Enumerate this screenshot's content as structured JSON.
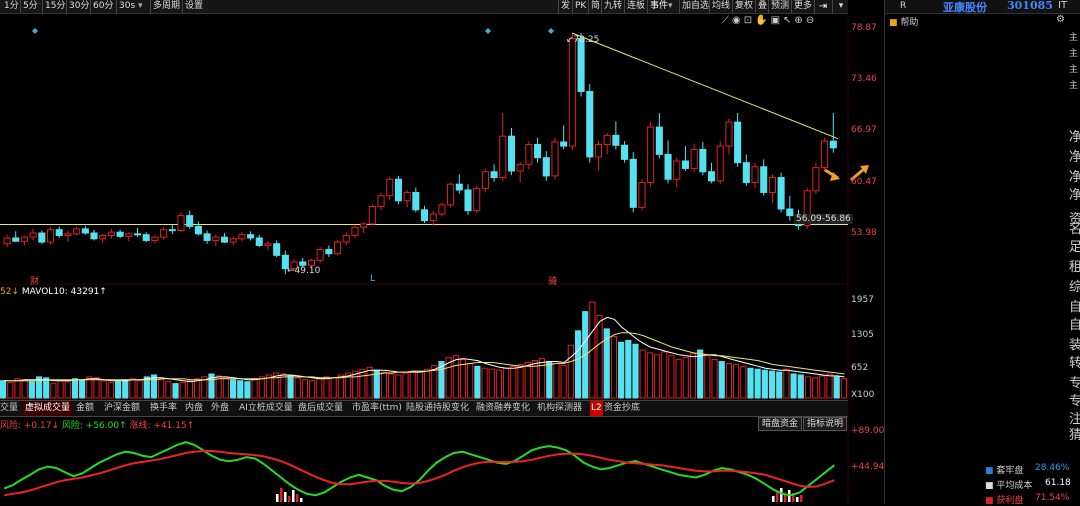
{
  "toolbar": {
    "periods": [
      "1分",
      "5分",
      "15分",
      "30分",
      "60分",
      "30s",
      "多周期",
      "设置"
    ],
    "tools": [
      "发",
      "PK",
      "简",
      "九转",
      "连板",
      "事件",
      "加自选",
      "均线",
      "复权",
      "叠",
      "预测",
      "更多"
    ]
  },
  "stock": {
    "code_letter": "R",
    "name": "亚康股份",
    "code": "301085",
    "help": "帮助",
    "it_label": "IT"
  },
  "price_axis": [
    "78.87",
    "73.46",
    "66.97",
    "60.47",
    "53.98"
  ],
  "annotations": {
    "high": "78.25",
    "low": "49.10",
    "box_label": "56.09-56.86",
    "marker_cai": "财",
    "marker_l": "L",
    "marker_xiang": "骑"
  },
  "volume": {
    "header_value": "52↓",
    "header": "MAVOL10: 43291↑",
    "axis": [
      "1957",
      "1305",
      "652",
      "X100"
    ],
    "bars": [
      18,
      16,
      20,
      19,
      17,
      22,
      21,
      15,
      18,
      17,
      20,
      19,
      22,
      21,
      18,
      16,
      17,
      19,
      20,
      18,
      22,
      24,
      19,
      17,
      15,
      16,
      18,
      20,
      22,
      25,
      23,
      21,
      19,
      18,
      17,
      20,
      22,
      24,
      26,
      25,
      23,
      21,
      19,
      18,
      20,
      22,
      21,
      24,
      26,
      28,
      30,
      32,
      29,
      27,
      25,
      24,
      26,
      28,
      27,
      30,
      34,
      38,
      42,
      44,
      40,
      36,
      33,
      31,
      30,
      29,
      31,
      33,
      35,
      37,
      39,
      41,
      38,
      36,
      34,
      55,
      70,
      90,
      100,
      86,
      72,
      64,
      58,
      60,
      56,
      50,
      47,
      45,
      48,
      44,
      40,
      42,
      46,
      50,
      44,
      40,
      38,
      36,
      35,
      33,
      31,
      30,
      29,
      28,
      27,
      30,
      25,
      24,
      22,
      21,
      23,
      25,
      22,
      20
    ],
    "ma5": [
      18,
      18,
      18,
      19,
      19,
      19,
      19,
      18,
      18,
      18,
      19,
      19,
      20,
      20,
      19,
      18,
      18,
      18,
      19,
      19,
      20,
      21,
      21,
      20,
      19,
      18,
      17,
      18,
      19,
      21,
      22,
      22,
      21,
      20,
      19,
      19,
      20,
      21,
      23,
      24,
      24,
      23,
      22,
      21,
      20,
      20,
      21,
      22,
      23,
      25,
      27,
      29,
      29,
      29,
      28,
      27,
      27,
      27,
      27,
      28,
      30,
      33,
      37,
      40,
      41,
      40,
      39,
      36,
      34,
      32,
      31,
      31,
      32,
      34,
      36,
      37,
      38,
      38,
      37,
      43,
      50,
      60,
      70,
      80,
      84,
      82,
      74,
      68,
      62,
      57,
      53,
      51,
      49,
      47,
      45,
      44,
      43,
      44,
      45,
      45,
      43,
      41,
      39,
      37,
      35,
      33,
      31,
      30,
      29,
      29,
      28,
      27,
      26,
      25,
      24,
      23,
      23,
      22
    ],
    "ma10": [
      18,
      18,
      18,
      18,
      18,
      18,
      19,
      19,
      19,
      19,
      19,
      19,
      19,
      19,
      19,
      19,
      19,
      19,
      19,
      19,
      19,
      19,
      20,
      20,
      20,
      20,
      19,
      19,
      19,
      19,
      20,
      20,
      20,
      20,
      20,
      20,
      20,
      21,
      21,
      22,
      22,
      22,
      22,
      22,
      21,
      21,
      21,
      21,
      22,
      22,
      23,
      24,
      25,
      26,
      26,
      27,
      27,
      28,
      28,
      28,
      29,
      30,
      32,
      34,
      35,
      36,
      37,
      37,
      37,
      36,
      35,
      34,
      33,
      33,
      33,
      34,
      35,
      36,
      36,
      38,
      41,
      45,
      51,
      57,
      62,
      66,
      68,
      68,
      67,
      65,
      62,
      59,
      56,
      53,
      51,
      49,
      47,
      46,
      45,
      44,
      44,
      43,
      42,
      41,
      40,
      39,
      37,
      35,
      34,
      33,
      32,
      31,
      30,
      29,
      28,
      27,
      26,
      25
    ]
  },
  "tabs": [
    "交量",
    "虚拟成交量",
    "金额",
    "沪深金额",
    "换手率",
    "内盘",
    "外盘",
    "AI立桩成交量",
    "盘后成交量",
    "市盈率(ttm)",
    "陆股通持股变化",
    "融资融券变化",
    "机构探测器",
    "L2",
    "资金抄底"
  ],
  "indicator": {
    "header": {
      "red": "风险: +0.17↓",
      "green": "风险: +56.00↑",
      "red2": "涨线: +41.15↑"
    },
    "buttons": [
      "暗盘资金",
      "指标说明"
    ],
    "axis": [
      "+89.00",
      "+44.94"
    ],
    "green_line": [
      20,
      25,
      33,
      40,
      48,
      52,
      50,
      44,
      38,
      42,
      50,
      58,
      64,
      70,
      74,
      72,
      68,
      66,
      72,
      78,
      84,
      88,
      84,
      76,
      68,
      62,
      60,
      62,
      66,
      64,
      56,
      46,
      36,
      26,
      18,
      12,
      10,
      14,
      22,
      30,
      36,
      40,
      36,
      32,
      24,
      18,
      16,
      22,
      32,
      46,
      58,
      66,
      72,
      74,
      70,
      66,
      62,
      58,
      56,
      60,
      68,
      76,
      80,
      82,
      80,
      76,
      68,
      58,
      52,
      48,
      50,
      54,
      58,
      60,
      56,
      52,
      48,
      44,
      40,
      38,
      36,
      40,
      46,
      50,
      48,
      44,
      40,
      34,
      26,
      18,
      12,
      10,
      14,
      24,
      34,
      44,
      54
    ],
    "red_line": [
      10,
      12,
      14,
      17,
      21,
      25,
      29,
      32,
      34,
      36,
      39,
      42,
      46,
      50,
      54,
      57,
      59,
      61,
      63,
      66,
      69,
      72,
      74,
      75,
      75,
      74,
      72,
      71,
      70,
      69,
      67,
      64,
      60,
      55,
      49,
      43,
      37,
      32,
      28,
      26,
      26,
      28,
      30,
      31,
      31,
      30,
      28,
      27,
      28,
      31,
      35,
      40,
      46,
      51,
      55,
      58,
      59,
      59,
      59,
      59,
      60,
      62,
      65,
      68,
      70,
      71,
      71,
      70,
      68,
      65,
      62,
      60,
      58,
      57,
      56,
      55,
      54,
      52,
      50,
      48,
      46,
      45,
      45,
      46,
      46,
      45,
      44,
      42,
      40,
      36,
      32,
      28,
      24,
      22,
      23,
      27,
      32
    ]
  },
  "side_labels": [
    "主",
    "主",
    "主",
    "主",
    "净",
    "净",
    "净",
    "净",
    "资",
    "名",
    "足",
    "租",
    "综",
    "自",
    "自",
    "装",
    "转",
    "专",
    "专",
    "注",
    "猜"
  ],
  "stats": [
    {
      "label": "套牢盘",
      "value": "28.46%",
      "color": "#2a7fd4"
    },
    {
      "label": "平均成本",
      "value": "61.18",
      "color": "#ffffff"
    },
    {
      "label": "获利盘",
      "value": "71.54%",
      "color": "#e02020"
    }
  ],
  "colors": {
    "up": "#e02020",
    "down": "#54e1f0",
    "trend": "#e8e870",
    "vol_ma5": "#ffffff",
    "vol_ma10": "#e8e870"
  },
  "candles": [
    [
      52.8,
      53.9,
      52.4,
      53.5
    ],
    [
      53.5,
      54.3,
      53.0,
      53.1
    ],
    [
      53.1,
      53.8,
      52.6,
      53.6
    ],
    [
      53.6,
      54.6,
      53.2,
      54.1
    ],
    [
      54.1,
      54.4,
      52.8,
      53.0
    ],
    [
      53.0,
      54.8,
      52.7,
      54.5
    ],
    [
      54.5,
      54.9,
      53.5,
      53.8
    ],
    [
      53.8,
      54.4,
      53.0,
      54.0
    ],
    [
      54.0,
      54.9,
      53.8,
      54.6
    ],
    [
      54.6,
      55.0,
      53.9,
      54.1
    ],
    [
      54.1,
      54.5,
      53.2,
      53.4
    ],
    [
      53.4,
      54.0,
      52.9,
      53.8
    ],
    [
      53.8,
      54.6,
      53.4,
      54.2
    ],
    [
      54.2,
      54.5,
      53.5,
      53.7
    ],
    [
      53.7,
      54.2,
      53.1,
      54.0
    ],
    [
      54.0,
      54.7,
      53.6,
      53.9
    ],
    [
      53.9,
      54.2,
      53.0,
      53.2
    ],
    [
      53.2,
      53.9,
      52.8,
      53.6
    ],
    [
      53.6,
      54.8,
      53.3,
      54.5
    ],
    [
      54.5,
      55.1,
      54.0,
      54.4
    ],
    [
      54.4,
      56.6,
      54.2,
      56.2
    ],
    [
      56.2,
      56.8,
      54.6,
      54.9
    ],
    [
      54.9,
      55.5,
      53.8,
      54.0
    ],
    [
      54.0,
      54.4,
      52.8,
      53.2
    ],
    [
      53.2,
      53.9,
      52.5,
      53.6
    ],
    [
      53.6,
      54.1,
      52.9,
      53.0
    ],
    [
      53.0,
      53.7,
      52.6,
      53.4
    ],
    [
      53.4,
      54.2,
      53.1,
      53.9
    ],
    [
      53.9,
      54.3,
      53.2,
      53.5
    ],
    [
      53.5,
      53.9,
      52.4,
      52.6
    ],
    [
      52.6,
      53.1,
      52.0,
      52.8
    ],
    [
      52.8,
      53.2,
      51.2,
      51.4
    ],
    [
      51.4,
      52.0,
      49.1,
      49.8
    ],
    [
      49.8,
      51.0,
      49.5,
      50.6
    ],
    [
      50.6,
      51.1,
      49.9,
      50.2
    ],
    [
      50.2,
      51.0,
      49.8,
      50.8
    ],
    [
      50.8,
      52.4,
      50.5,
      52.1
    ],
    [
      52.1,
      52.6,
      51.2,
      51.6
    ],
    [
      51.6,
      53.3,
      51.4,
      53.0
    ],
    [
      53.0,
      54.2,
      52.6,
      53.8
    ],
    [
      53.8,
      55.1,
      53.5,
      54.8
    ],
    [
      54.8,
      55.4,
      54.1,
      55.2
    ],
    [
      55.2,
      57.6,
      55.0,
      57.3
    ],
    [
      57.3,
      59.0,
      56.9,
      58.6
    ],
    [
      58.6,
      60.9,
      58.1,
      60.6
    ],
    [
      60.6,
      61.0,
      57.6,
      58.0
    ],
    [
      58.0,
      59.3,
      57.2,
      59.0
    ],
    [
      59.0,
      59.6,
      56.6,
      56.9
    ],
    [
      56.9,
      57.4,
      55.3,
      55.6
    ],
    [
      55.6,
      56.8,
      55.0,
      56.4
    ],
    [
      56.4,
      57.8,
      56.1,
      57.5
    ],
    [
      57.5,
      60.2,
      57.2,
      60.0
    ],
    [
      60.0,
      61.2,
      58.9,
      59.3
    ],
    [
      59.3,
      60.0,
      56.3,
      56.8
    ],
    [
      56.8,
      59.8,
      56.5,
      59.5
    ],
    [
      59.5,
      61.8,
      59.0,
      61.5
    ],
    [
      61.5,
      62.4,
      60.3,
      60.8
    ],
    [
      60.8,
      68.6,
      60.4,
      65.8
    ],
    [
      65.8,
      66.8,
      61.1,
      61.6
    ],
    [
      61.6,
      62.7,
      60.2,
      62.4
    ],
    [
      62.4,
      65.2,
      61.8,
      64.8
    ],
    [
      64.8,
      65.6,
      62.6,
      63.2
    ],
    [
      63.2,
      64.0,
      60.4,
      61.0
    ],
    [
      61.0,
      65.6,
      60.6,
      65.1
    ],
    [
      65.1,
      67.1,
      64.2,
      64.6
    ],
    [
      64.6,
      78.3,
      64.1,
      77.6
    ],
    [
      77.6,
      78.25,
      70.6,
      71.2
    ],
    [
      71.2,
      72.1,
      62.6,
      63.3
    ],
    [
      63.3,
      65.2,
      61.6,
      64.8
    ],
    [
      64.8,
      66.2,
      63.6,
      65.9
    ],
    [
      65.9,
      67.6,
      64.2,
      64.7
    ],
    [
      64.7,
      65.2,
      62.6,
      63.0
    ],
    [
      63.0,
      63.9,
      56.6,
      57.2
    ],
    [
      57.2,
      60.6,
      56.8,
      60.2
    ],
    [
      60.2,
      67.6,
      59.6,
      66.9
    ],
    [
      66.9,
      68.6,
      63.1,
      63.6
    ],
    [
      63.6,
      65.3,
      60.1,
      60.6
    ],
    [
      60.6,
      63.2,
      59.6,
      62.8
    ],
    [
      62.8,
      64.6,
      61.6,
      61.9
    ],
    [
      61.9,
      64.9,
      61.4,
      64.2
    ],
    [
      64.2,
      65.1,
      61.1,
      61.5
    ],
    [
      61.5,
      62.6,
      60.1,
      60.4
    ],
    [
      60.4,
      65.2,
      60.0,
      64.6
    ],
    [
      64.6,
      67.9,
      63.6,
      67.5
    ],
    [
      67.5,
      68.6,
      62.1,
      62.6
    ],
    [
      62.6,
      63.6,
      59.8,
      60.2
    ],
    [
      60.2,
      62.6,
      59.5,
      62.1
    ],
    [
      62.1,
      63.0,
      58.6,
      59.0
    ],
    [
      59.0,
      61.2,
      57.8,
      60.8
    ],
    [
      60.8,
      61.4,
      56.6,
      57.0
    ],
    [
      57.0,
      58.6,
      55.6,
      56.2
    ],
    [
      56.2,
      56.9,
      54.5,
      55.0
    ],
    [
      55.0,
      59.6,
      54.6,
      59.2
    ],
    [
      59.2,
      62.6,
      58.8,
      62.0
    ],
    [
      62.0,
      65.6,
      61.5,
      65.2
    ],
    [
      65.2,
      68.6,
      63.8,
      64.4
    ]
  ],
  "chip": {
    "red": [
      [
        130,
        9
      ],
      [
        150,
        14
      ],
      [
        155,
        22
      ],
      [
        160,
        55
      ],
      [
        165,
        48
      ],
      [
        170,
        35
      ],
      [
        176,
        20
      ],
      [
        182,
        40
      ],
      [
        186,
        180
      ],
      [
        190,
        60
      ],
      [
        195,
        25
      ],
      [
        200,
        18
      ],
      [
        205,
        12
      ],
      [
        210,
        30
      ],
      [
        215,
        40
      ],
      [
        220,
        28
      ],
      [
        225,
        18
      ],
      [
        230,
        12
      ],
      [
        235,
        8
      ]
    ],
    "blue": [
      [
        110,
        12
      ],
      [
        118,
        20
      ],
      [
        124,
        34
      ],
      [
        128,
        48
      ],
      [
        132,
        60
      ],
      [
        136,
        80
      ],
      [
        140,
        112
      ],
      [
        143,
        98
      ],
      [
        146,
        60
      ]
    ]
  }
}
